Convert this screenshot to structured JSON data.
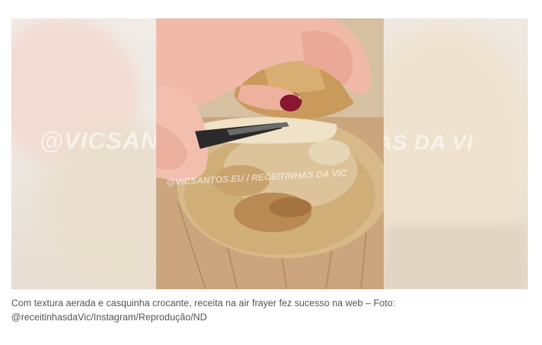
{
  "image": {
    "alt": "Pão de air fryer sendo cortado com faca",
    "watermark_left": "@VICSANT",
    "watermark_center": "@VICSANTOS.EU / RECEITINHAS DA VIC",
    "watermark_right": "AS DA VI"
  },
  "caption": {
    "line1": "Com textura aerada e casquinha crocante, receita na air frayer fez sucesso na web – Foto:",
    "line2": "@receitinhasdaVic/Instagram/Reprodução/ND"
  },
  "colors": {
    "caption_text": "#555555",
    "background": "#ffffff"
  }
}
